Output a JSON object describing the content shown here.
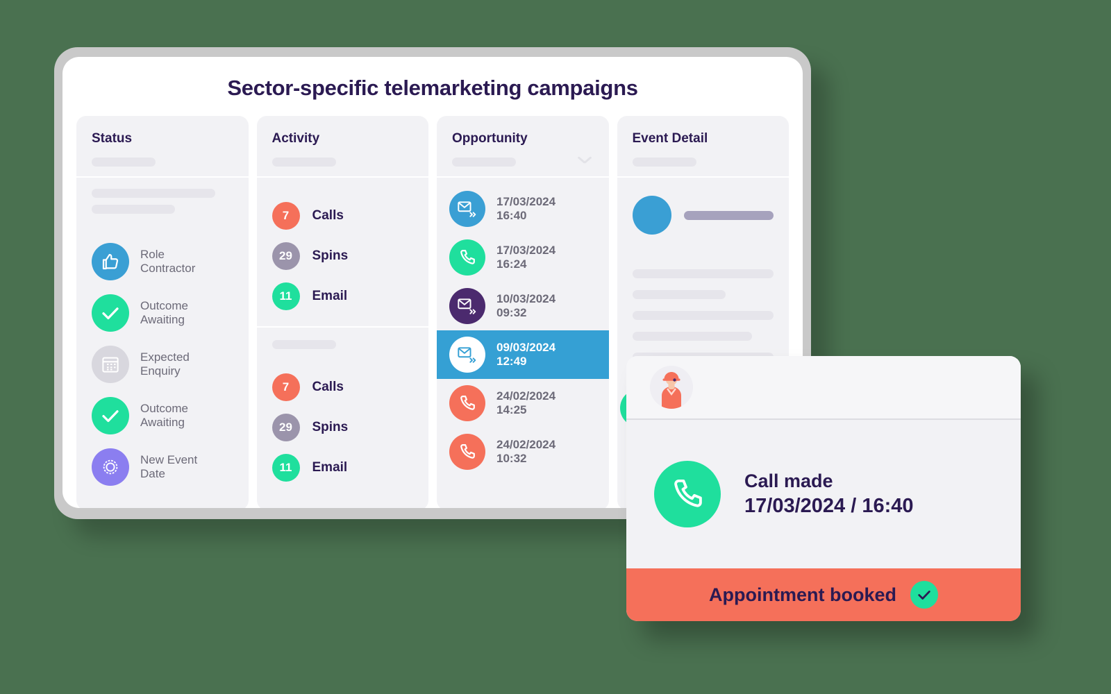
{
  "page_title": "Sector-specific telemarketing campaigns",
  "colors": {
    "background": "#4a7150",
    "title": "#2b1a52",
    "accent_blue": "#35a0d4",
    "accent_green": "#1fdf9d",
    "accent_orange": "#f5705a",
    "accent_purple": "#8b7ef0",
    "panel": "#f2f2f5"
  },
  "columns": {
    "status": {
      "title": "Status",
      "items": [
        {
          "label": "Role\nContractor",
          "icon": "thumbs-up-icon",
          "color": "#3a9fd4"
        },
        {
          "label": "Outcome\nAwaiting",
          "icon": "check-icon",
          "color": "#1fdf9d"
        },
        {
          "label": "Expected\nEnquiry",
          "icon": "calendar-icon",
          "color": "#d8d7de"
        },
        {
          "label": "Outcome\nAwaiting",
          "icon": "check-icon",
          "color": "#1fdf9d"
        },
        {
          "label": "New Event\nDate",
          "icon": "badge-icon",
          "color": "#8b7ef0"
        }
      ]
    },
    "activity": {
      "title": "Activity",
      "group_one": [
        {
          "count": "7",
          "label": "Calls",
          "color": "#f5705a"
        },
        {
          "count": "29",
          "label": "Spins",
          "color": "#9b94ab"
        },
        {
          "count": "11",
          "label": "Email",
          "color": "#1fdf9d"
        }
      ],
      "group_two": [
        {
          "count": "7",
          "label": "Calls",
          "color": "#f5705a"
        },
        {
          "count": "29",
          "label": "Spins",
          "color": "#9b94ab"
        },
        {
          "count": "11",
          "label": "Email",
          "color": "#1fdf9d"
        }
      ]
    },
    "opportunity": {
      "title": "Opportunity",
      "items": [
        {
          "date": "17/03/2024\n16:40",
          "icon": "email-sent-icon",
          "color": "#3a9fd4",
          "icon_color": "#ffffff",
          "selected": false
        },
        {
          "date": "17/03/2024\n16:24",
          "icon": "phone-icon",
          "color": "#1fdf9d",
          "icon_color": "#ffffff",
          "selected": false
        },
        {
          "date": "10/03/2024\n09:32",
          "icon": "email-sent-icon",
          "color": "#4b2a6e",
          "icon_color": "#ffffff",
          "selected": false
        },
        {
          "date": "09/03/2024\n12:49",
          "icon": "email-sent-icon",
          "color": "#ffffff",
          "icon_color": "#35a0d4",
          "selected": true
        },
        {
          "date": "24/02/2024\n14:25",
          "icon": "phone-icon",
          "color": "#f5705a",
          "icon_color": "#ffffff",
          "selected": false
        },
        {
          "date": "24/02/2024\n10:32",
          "icon": "phone-icon",
          "color": "#f5705a",
          "icon_color": "#ffffff",
          "selected": false
        }
      ]
    },
    "event_detail": {
      "title": "Event Detail"
    }
  },
  "call_card": {
    "avatar": "construction-worker-avatar",
    "call_title": "Call made",
    "call_datetime": "17/03/2024 / 16:40",
    "footer_label": "Appointment booked"
  }
}
